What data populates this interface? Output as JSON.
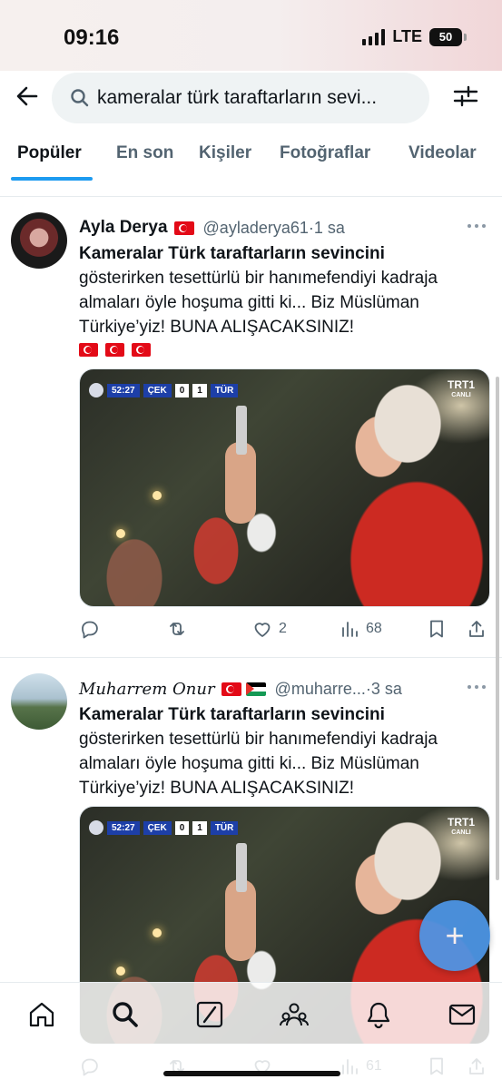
{
  "status": {
    "time": "09:16",
    "network": "LTE",
    "battery": "50"
  },
  "search": {
    "query": "kameralar türk taraftarların sevi..."
  },
  "tabs": [
    {
      "label": "Popüler",
      "active": true
    },
    {
      "label": "En son"
    },
    {
      "label": "Kişiler"
    },
    {
      "label": "Fotoğraflar"
    },
    {
      "label": "Videolar"
    }
  ],
  "tweets": [
    {
      "name": "Ayla Derya",
      "handle": "@ayladerya61",
      "time": "·1 sa",
      "body_bold": "Kameralar Türk taraftarların sevincini",
      "body_lines": [
        "gösterirken tesettürlü bir hanımefendiyi kadraja",
        "almaları öyle hoşuma gitti ki... Biz Müslüman",
        "Türkiye’yiz! BUNA ALIŞACAKSINIZ!"
      ],
      "media_score": {
        "clock": "52:27",
        "home": "ÇEK",
        "home_score": "0",
        "away_score": "1",
        "away": "TÜR"
      },
      "media_channel": "TRT1",
      "media_channel_sub": "CANLI",
      "likes": "2",
      "views": "68"
    },
    {
      "name": "Muharrem Onur",
      "handle": "@muharre...",
      "time": "·3 sa",
      "body_bold": "Kameralar Türk taraftarların sevincini",
      "body_lines": [
        "gösterirken tesettürlü bir hanımefendiyi kadraja",
        "almaları öyle hoşuma gitti ki... Biz Müslüman",
        "Türkiye’yiz! BUNA ALIŞACAKSINIZ!"
      ],
      "media_score": {
        "clock": "52:27",
        "home": "ÇEK",
        "home_score": "0",
        "away_score": "1",
        "away": "TÜR"
      },
      "media_channel": "TRT1",
      "media_channel_sub": "CANLI",
      "views": "61"
    }
  ],
  "fab": {
    "label": "+"
  },
  "nav": [
    "home-icon",
    "search-icon",
    "grok-icon",
    "communities-icon",
    "notifications-icon",
    "messages-icon"
  ],
  "colors": {
    "accent": "#1d9bf0",
    "text": "#0f1419",
    "muted": "#536471"
  }
}
